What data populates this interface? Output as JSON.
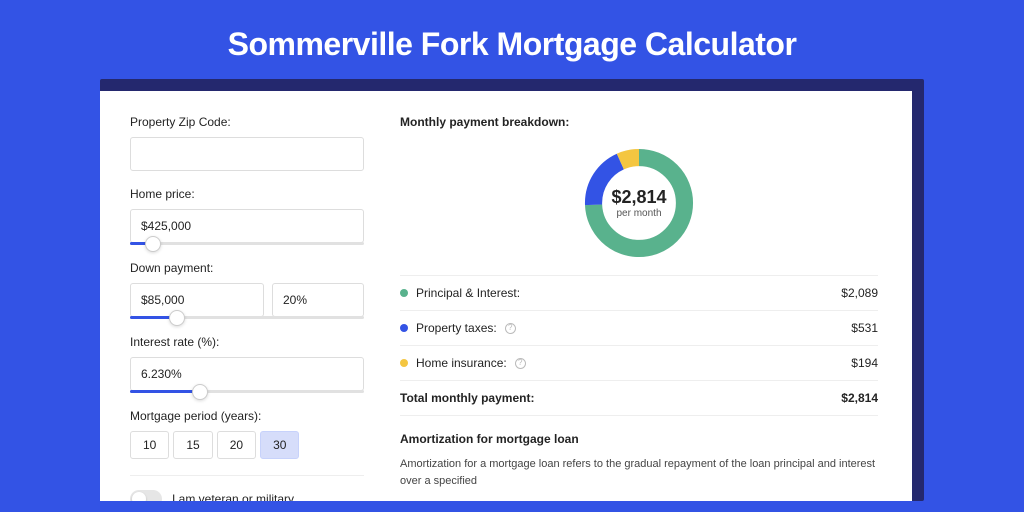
{
  "colors": {
    "green": "#59b28d",
    "blue": "#3353e5",
    "yellow": "#f4c641"
  },
  "title": "Sommerville Fork Mortgage Calculator",
  "form": {
    "zip": {
      "label": "Property Zip Code:",
      "value": ""
    },
    "price": {
      "label": "Home price:",
      "value": "$425,000",
      "slider_pct": 10
    },
    "down": {
      "label": "Down payment:",
      "amount": "$85,000",
      "pct": "20%",
      "slider_pct": 20
    },
    "rate": {
      "label": "Interest rate (%):",
      "value": "6.230%",
      "slider_pct": 30
    },
    "period": {
      "label": "Mortgage period (years):",
      "options": [
        "10",
        "15",
        "20",
        "30"
      ],
      "active": "30"
    },
    "veteran": {
      "label": "I am veteran or military",
      "on": false
    }
  },
  "breakdown": {
    "heading": "Monthly payment breakdown:",
    "total": {
      "amount": "$2,814",
      "unit": "per month"
    },
    "items": [
      {
        "key": "pi",
        "label": "Principal & Interest:",
        "value": "$2,089",
        "info": false
      },
      {
        "key": "tax",
        "label": "Property taxes:",
        "value": "$531",
        "info": true
      },
      {
        "key": "ins",
        "label": "Home insurance:",
        "value": "$194",
        "info": true
      }
    ],
    "total_row": {
      "label": "Total monthly payment:",
      "value": "$2,814"
    }
  },
  "chart_data": {
    "type": "pie",
    "title": "Monthly payment breakdown",
    "series": [
      {
        "name": "Principal & Interest",
        "value": 2089,
        "color": "#59b28d"
      },
      {
        "name": "Property taxes",
        "value": 531,
        "color": "#3353e5"
      },
      {
        "name": "Home insurance",
        "value": 194,
        "color": "#f4c641"
      }
    ],
    "center_label": "$2,814",
    "center_sub": "per month"
  },
  "amort": {
    "title": "Amortization for mortgage loan",
    "text": "Amortization for a mortgage loan refers to the gradual repayment of the loan principal and interest over a specified"
  }
}
